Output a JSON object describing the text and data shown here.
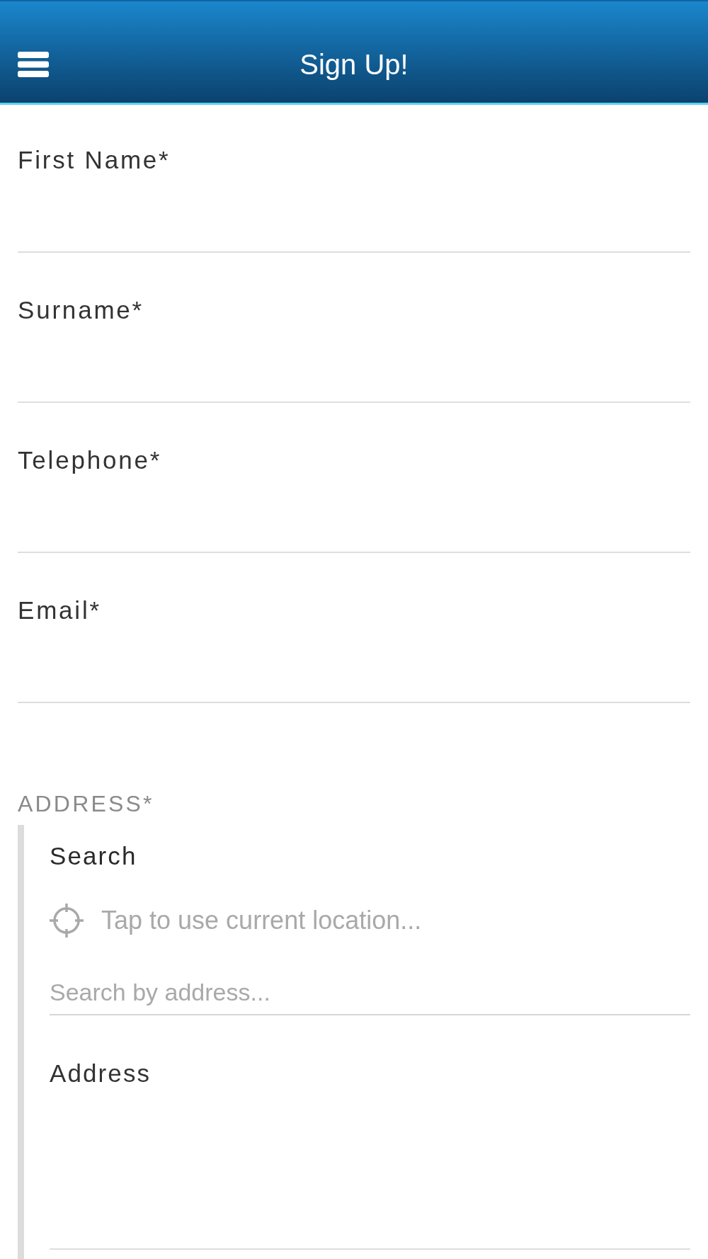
{
  "header": {
    "title": "Sign Up!"
  },
  "fields": [
    {
      "label": "First Name*"
    },
    {
      "label": "Surname*"
    },
    {
      "label": "Telephone*"
    },
    {
      "label": "Email*"
    }
  ],
  "address": {
    "heading": "ADDRESS*",
    "search": {
      "label": "Search",
      "location_hint": "Tap to use current location...",
      "placeholder": "Search by address..."
    },
    "address_field": {
      "label": "Address"
    }
  }
}
